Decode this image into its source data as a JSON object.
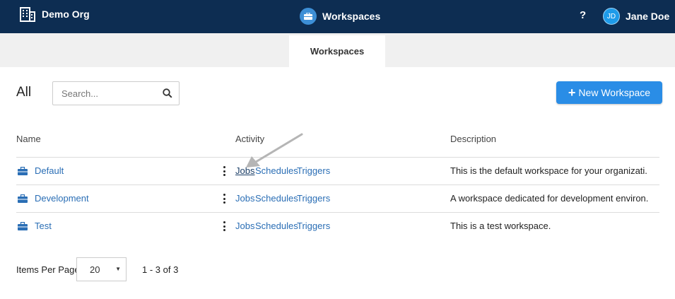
{
  "header": {
    "org_name": "Demo Org",
    "org_icon": "building-icon",
    "app_title": "Workspaces",
    "app_icon": "briefcase-icon",
    "help_label": "?",
    "user_initials": "JD",
    "user_name": "Jane Doe"
  },
  "tabs": {
    "active_label": "Workspaces"
  },
  "toolbar": {
    "filter_label": "All",
    "search_placeholder": "Search...",
    "search_value": "",
    "new_button_icon": "+",
    "new_button_label": "New Workspace"
  },
  "table": {
    "columns": [
      "Name",
      "Activity",
      "Description"
    ],
    "rows": [
      {
        "name": "Default",
        "activity": [
          "Jobs",
          "Schedules",
          "Triggers"
        ],
        "description": "This is the default workspace for your organizati..."
      },
      {
        "name": "Development",
        "activity": [
          "Jobs",
          "Schedules",
          "Triggers"
        ],
        "description": "A workspace dedicated for development environ..."
      },
      {
        "name": "Test",
        "activity": [
          "Jobs",
          "Schedules",
          "Triggers"
        ],
        "description": "This is a test workspace."
      }
    ]
  },
  "pagination": {
    "items_per_page_label": "Items Per Page",
    "items_per_page_value": "20",
    "range_text": "1 - 3 of 3"
  },
  "colors": {
    "topbar": "#0d2d52",
    "accent": "#2a8de6",
    "link": "#2a6eb5"
  }
}
